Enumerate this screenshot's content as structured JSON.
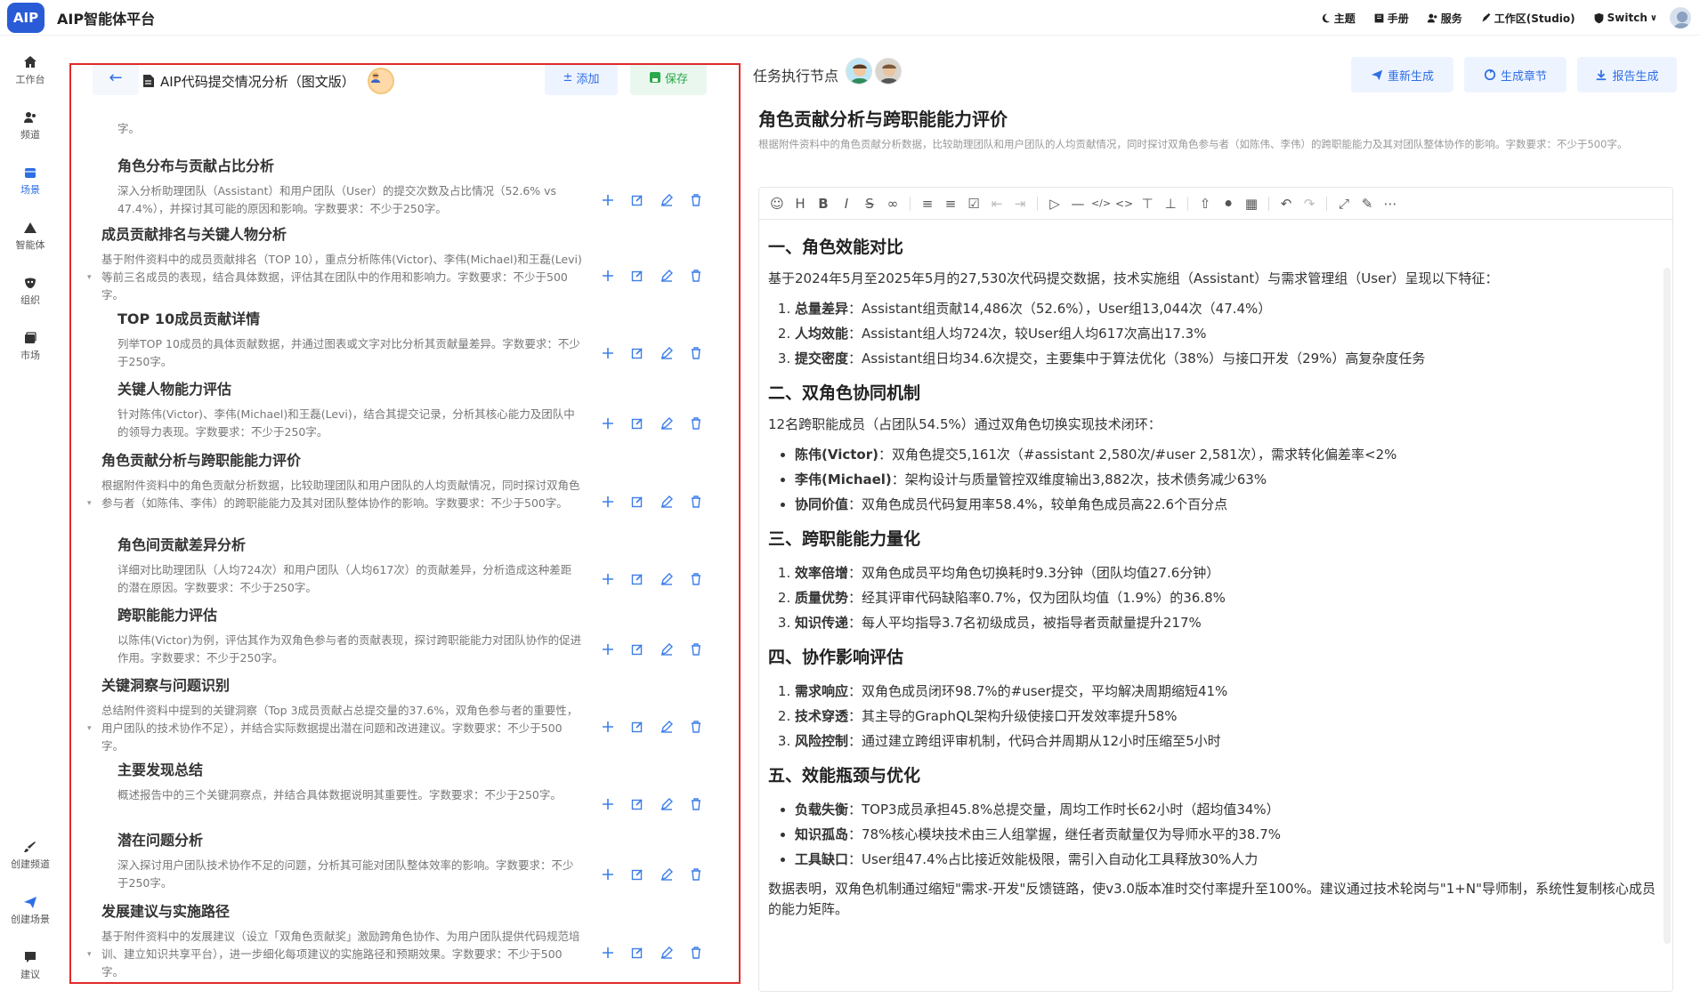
{
  "app": {
    "logo": "AIP",
    "title": "AIP智能体平台"
  },
  "topnav": [
    {
      "label": "主题",
      "icon": "moon-icon"
    },
    {
      "label": "手册",
      "icon": "book-icon"
    },
    {
      "label": "服务",
      "icon": "users-icon"
    },
    {
      "label": "工作区(Studio)",
      "icon": "pen-icon"
    },
    {
      "label": "Switch",
      "icon": "shield-icon"
    }
  ],
  "sidebar": {
    "top": [
      {
        "label": "工作台",
        "icon": "home-icon"
      },
      {
        "label": "频道",
        "icon": "users-icon"
      },
      {
        "label": "场景",
        "icon": "grid-icon"
      },
      {
        "label": "智能体",
        "icon": "triangle-icon"
      },
      {
        "label": "组织",
        "icon": "mask-icon"
      },
      {
        "label": "市场",
        "icon": "store-icon"
      }
    ],
    "bottom": [
      {
        "label": "创建频道",
        "icon": "brush-icon"
      },
      {
        "label": "创建场景",
        "icon": "send-icon"
      },
      {
        "label": "建议",
        "icon": "chat-icon"
      }
    ]
  },
  "left": {
    "title": "AIP代码提交情况分析（图文版）",
    "add_label": "添加",
    "save_label": "保存",
    "outline": [
      {
        "level": 2,
        "title": "",
        "desc": "字。"
      },
      {
        "level": 2,
        "title": "角色分布与贡献占比分析",
        "desc": "深入分析助理团队（Assistant）和用户团队（User）的提交次数及占比情况（52.6% vs 47.4%），并探讨其可能的原因和影响。字数要求：不少于250字。"
      },
      {
        "level": 1,
        "title": "成员贡献排名与关键人物分析",
        "desc": "基于附件资料中的成员贡献排名（TOP 10），重点分析陈伟(Victor)、李伟(Michael)和王磊(Levi)等前三名成员的表现，结合具体数据，评估其在团队中的作用和影响力。字数要求：不少于500字。"
      },
      {
        "level": 2,
        "title": "TOP 10成员贡献详情",
        "desc": "列举TOP 10成员的具体贡献数据，并通过图表或文字对比分析其贡献量差异。字数要求：不少于250字。"
      },
      {
        "level": 2,
        "title": "关键人物能力评估",
        "desc": "针对陈伟(Victor)、李伟(Michael)和王磊(Levi)，结合其提交记录，分析其核心能力及团队中的领导力表现。字数要求：不少于250字。"
      },
      {
        "level": 1,
        "title": "角色贡献分析与跨职能能力评价",
        "desc": "根据附件资料中的角色贡献分析数据，比较助理团队和用户团队的人均贡献情况，同时探讨双角色参与者（如陈伟、李伟）的跨职能能力及其对团队整体协作的影响。字数要求：不少于500字。"
      },
      {
        "level": 2,
        "title": "角色间贡献差异分析",
        "desc": "详细对比助理团队（人均724次）和用户团队（人均617次）的贡献差异，分析造成这种差距的潜在原因。字数要求：不少于250字。"
      },
      {
        "level": 2,
        "title": "跨职能能力评估",
        "desc": "以陈伟(Victor)为例，评估其作为双角色参与者的贡献表现，探讨跨职能能力对团队协作的促进作用。字数要求：不少于250字。"
      },
      {
        "level": 1,
        "title": "关键洞察与问题识别",
        "desc": "总结附件资料中提到的关键洞察（Top 3成员贡献占总提交量的37.6%，双角色参与者的重要性，用户团队的技术协作不足），并结合实际数据提出潜在问题和改进建议。字数要求：不少于500字。"
      },
      {
        "level": 2,
        "title": "主要发现总结",
        "desc": "概述报告中的三个关键洞察点，并结合具体数据说明其重要性。字数要求：不少于250字。"
      },
      {
        "level": 2,
        "title": "潜在问题分析",
        "desc": "深入探讨用户团队技术协作不足的问题，分析其可能对团队整体效率的影响。字数要求：不少于250字。"
      },
      {
        "level": 1,
        "title": "发展建议与实施路径",
        "desc": "基于附件资料中的发展建议（设立「双角色贡献奖」激励跨角色协作、为用户团队提供代码规范培训、建立知识共享平台），进一步细化每项建议的实施路径和预期效果。字数要求：不少于500字。"
      }
    ]
  },
  "right": {
    "node_label": "任务执行节点",
    "buttons": [
      {
        "label": "重新生成",
        "icon": "send-icon"
      },
      {
        "label": "生成章节",
        "icon": "refresh-icon"
      },
      {
        "label": "报告生成",
        "icon": "download-icon"
      }
    ],
    "section_title": "角色贡献分析与跨职能能力评价",
    "section_desc": "根据附件资料中的角色贡献分析数据，比较助理团队和用户团队的人均贡献情况，同时探讨双角色参与者（如陈伟、李伟）的跨职能能力及其对团队整体协作的影响。字数要求：不少于500字。",
    "content": {
      "h1": "一、角色效能对比",
      "p1": "基于2024年5月至2025年5月的27,530次代码提交数据，技术实施组（Assistant）与需求管理组（User）呈现以下特征：",
      "l1": [
        {
          "k": "总量差异",
          "v": "：Assistant组贡献14,486次（52.6%），User组13,044次（47.4%）"
        },
        {
          "k": "人均效能",
          "v": "：Assistant组人均724次，较User组人均617次高出17.3%"
        },
        {
          "k": "提交密度",
          "v": "：Assistant组日均34.6次提交，主要集中于算法优化（38%）与接口开发（29%）高复杂度任务"
        }
      ],
      "h2": "二、双角色协同机制",
      "p2": "12名跨职能成员（占团队54.5%）通过双角色切换实现技术闭环：",
      "l2": [
        {
          "k": "陈伟(Victor)",
          "v": "：双角色提交5,161次（#assistant 2,580次/#user 2,581次），需求转化偏差率<2%"
        },
        {
          "k": "李伟(Michael)",
          "v": "：架构设计与质量管控双维度输出3,882次，技术债务减少63%"
        },
        {
          "k": "协同价值",
          "v": "：双角色成员代码复用率58.4%，较单角色成员高22.6个百分点"
        }
      ],
      "h3": "三、跨职能能力量化",
      "l3": [
        {
          "k": "效率倍增",
          "v": "：双角色成员平均角色切换耗时9.3分钟（团队均值27.6分钟）"
        },
        {
          "k": "质量优势",
          "v": "：经其评审代码缺陷率0.7%，仅为团队均值（1.9%）的36.8%"
        },
        {
          "k": "知识传递",
          "v": "：每人平均指导3.7名初级成员，被指导者贡献量提升217%"
        }
      ],
      "h4": "四、协作影响评估",
      "l4": [
        {
          "k": "需求响应",
          "v": "：双角色成员闭环98.7%的#user提交，平均解决周期缩短41%"
        },
        {
          "k": "技术穿透",
          "v": "：其主导的GraphQL架构升级使接口开发效率提升58%"
        },
        {
          "k": "风险控制",
          "v": "：通过建立跨组评审机制，代码合并周期从12小时压缩至5小时"
        }
      ],
      "h5": "五、效能瓶颈与优化",
      "l5": [
        {
          "k": "负载失衡",
          "v": "：TOP3成员承担45.8%总提交量，周均工作时长62小时（超均值34%）"
        },
        {
          "k": "知识孤岛",
          "v": "：78%核心模块技术由三人组掌握，继任者贡献量仅为导师水平的38.7%"
        },
        {
          "k": "工具缺口",
          "v": "：User组47.4%占比接近效能极限，需引入自动化工具释放30%人力"
        }
      ],
      "p_end": "数据表明，双角色机制通过缩短\"需求-开发\"反馈链路，使v3.0版本准时交付率提升至100%。建议通过技术轮岗与\"1+N\"导师制，系统性复制核心成员的能力矩阵。"
    }
  },
  "colors": {
    "accent": "#2f6fe4",
    "save": "#2aa84a",
    "highlight": "#e02a2a"
  }
}
